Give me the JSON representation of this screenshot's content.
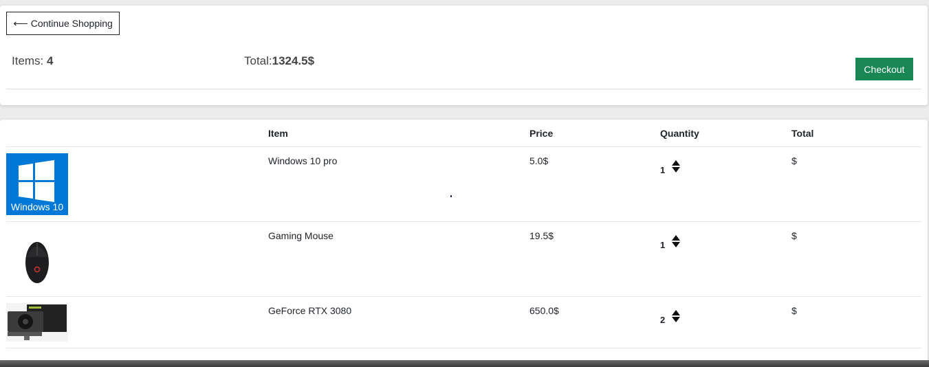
{
  "summary": {
    "continue_label": "Continue Shopping",
    "items_label": "Items: ",
    "items_count": "4",
    "total_label": "Total:",
    "total_value": "1324.5$",
    "checkout_label": "Checkout"
  },
  "table": {
    "headers": [
      "Item",
      "Price",
      "Quantity",
      "Total"
    ],
    "rows": [
      {
        "name": "Windows 10 pro",
        "price": "5.0$",
        "quantity": "1",
        "total": "$",
        "image_text": "Windows 10"
      },
      {
        "name": "Gaming Mouse",
        "price": "19.5$",
        "quantity": "1",
        "total": "$"
      },
      {
        "name": "GeForce RTX 3080",
        "price": "650.0$",
        "quantity": "2",
        "total": "$"
      }
    ]
  },
  "colors": {
    "checkout": "#198754",
    "windows_tile": "#0078d7"
  }
}
